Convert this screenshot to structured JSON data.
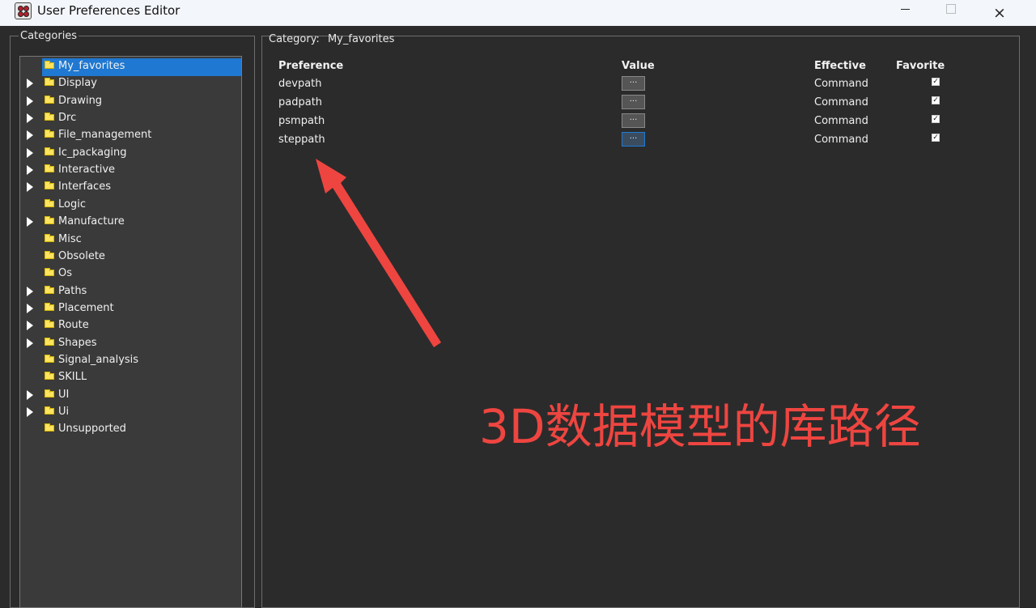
{
  "window": {
    "title": "User Preferences Editor",
    "minimize_label": "—",
    "maximize_label": "",
    "close_label": "×"
  },
  "categories": {
    "legend": "Categories",
    "items": [
      {
        "label": "My_favorites",
        "expandable": false,
        "selected": true
      },
      {
        "label": "Display",
        "expandable": true,
        "selected": false
      },
      {
        "label": "Drawing",
        "expandable": true,
        "selected": false
      },
      {
        "label": "Drc",
        "expandable": true,
        "selected": false
      },
      {
        "label": "File_management",
        "expandable": true,
        "selected": false
      },
      {
        "label": "Ic_packaging",
        "expandable": true,
        "selected": false
      },
      {
        "label": "Interactive",
        "expandable": true,
        "selected": false
      },
      {
        "label": "Interfaces",
        "expandable": true,
        "selected": false
      },
      {
        "label": "Logic",
        "expandable": false,
        "selected": false
      },
      {
        "label": "Manufacture",
        "expandable": true,
        "selected": false
      },
      {
        "label": "Misc",
        "expandable": false,
        "selected": false
      },
      {
        "label": "Obsolete",
        "expandable": false,
        "selected": false
      },
      {
        "label": "Os",
        "expandable": false,
        "selected": false
      },
      {
        "label": "Paths",
        "expandable": true,
        "selected": false
      },
      {
        "label": "Placement",
        "expandable": true,
        "selected": false
      },
      {
        "label": "Route",
        "expandable": true,
        "selected": false
      },
      {
        "label": "Shapes",
        "expandable": true,
        "selected": false
      },
      {
        "label": "Signal_analysis",
        "expandable": false,
        "selected": false
      },
      {
        "label": "SKILL",
        "expandable": false,
        "selected": false
      },
      {
        "label": "UI",
        "expandable": true,
        "selected": false
      },
      {
        "label": "Ui",
        "expandable": true,
        "selected": false
      },
      {
        "label": "Unsupported",
        "expandable": false,
        "selected": false
      }
    ]
  },
  "category_panel": {
    "label": "Category:",
    "value": "My_favorites",
    "headers": {
      "preference": "Preference",
      "value": "Value",
      "effective": "Effective",
      "favorite": "Favorite"
    },
    "rows": [
      {
        "preference": "devpath",
        "value_button": "...",
        "effective": "Command",
        "favorite": "✓"
      },
      {
        "preference": "padpath",
        "value_button": "...",
        "effective": "Command",
        "favorite": "✓"
      },
      {
        "preference": "psmpath",
        "value_button": "...",
        "effective": "Command",
        "favorite": "✓"
      },
      {
        "preference": "steppath",
        "value_button": "...",
        "effective": "Command",
        "favorite": "✓"
      }
    ]
  },
  "annotation": {
    "text": "3D数据模型的库路径",
    "color": "#ee4540"
  },
  "colors": {
    "selected": "#1f78d1",
    "folder": "#ffe45c",
    "window_bg": "#2b2b2b",
    "titlebar_bg": "#f3f6fb"
  }
}
